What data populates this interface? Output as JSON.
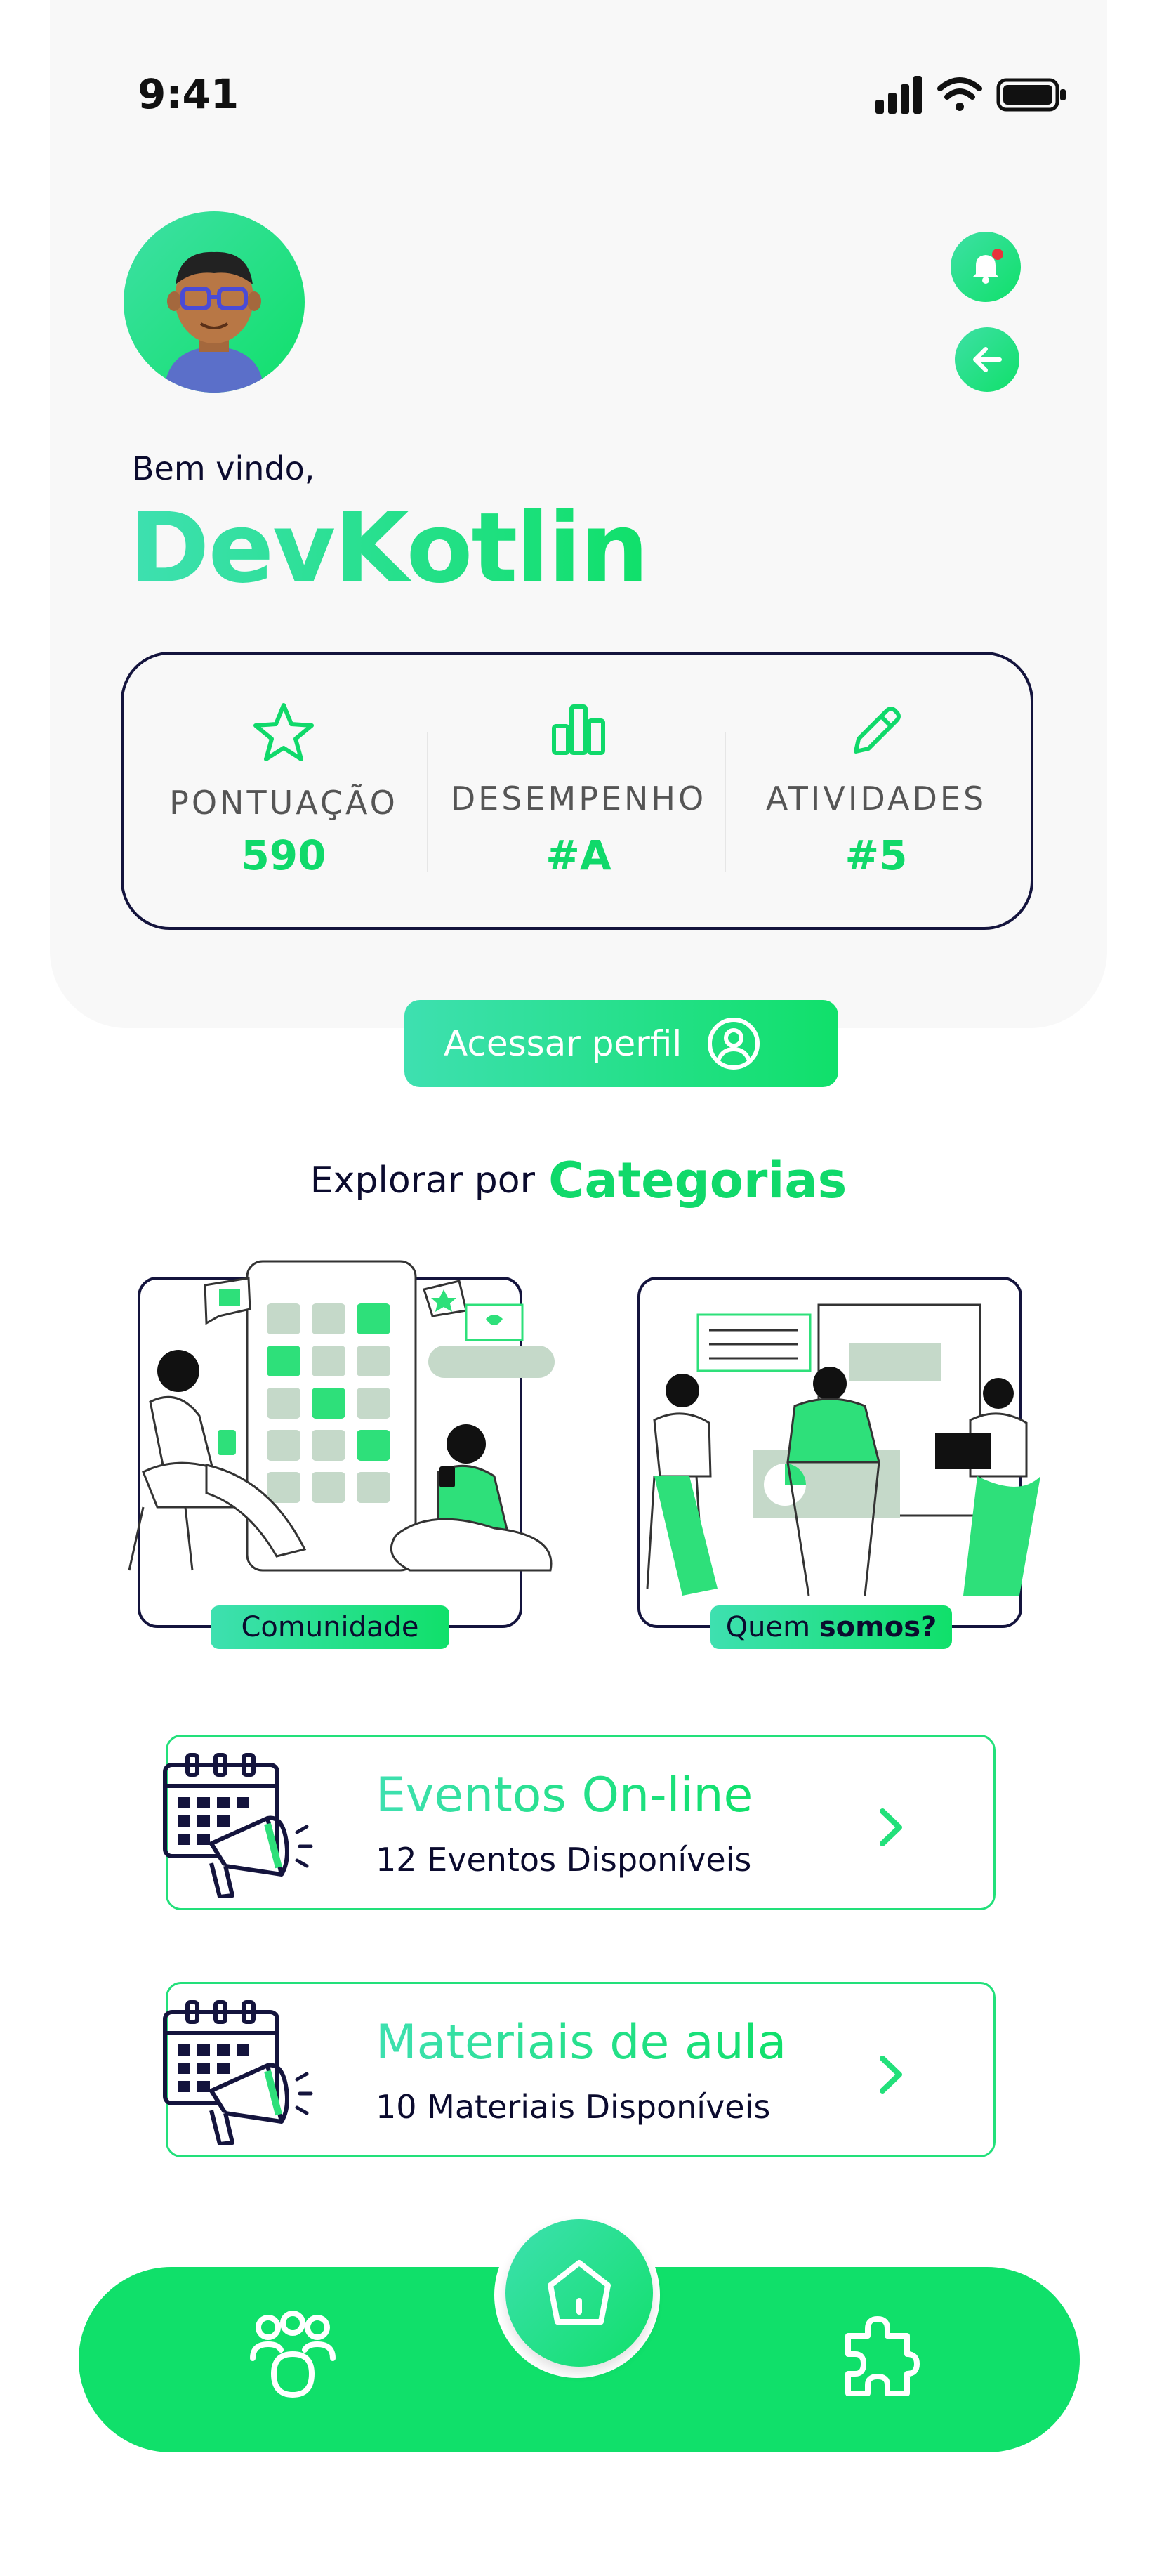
{
  "status": {
    "time": "9:41"
  },
  "header": {
    "welcome": "Bem vindo,",
    "username": "DevKotlin"
  },
  "stats": [
    {
      "label": "PONTUAÇÃO",
      "value": "590",
      "icon": "star-icon"
    },
    {
      "label": "DESEMPENHO",
      "value": "#A",
      "icon": "bar-chart-icon"
    },
    {
      "label": "ATIVIDADES",
      "value": "#5",
      "icon": "pencil-icon"
    }
  ],
  "profile_button": {
    "label": "Acessar perfil",
    "icon": "user-circle-icon"
  },
  "explore": {
    "prefix": "Explorar por",
    "highlight": "Categorias"
  },
  "categories": [
    {
      "label": "Comunidade"
    },
    {
      "label_plain": "Quem",
      "label_bold": "somos?"
    }
  ],
  "list": [
    {
      "title": "Eventos On-line",
      "subtitle": "12 Eventos Disponíveis"
    },
    {
      "title": "Materiais de aula",
      "subtitle": "10 Materiais Disponíveis"
    }
  ],
  "nav": {
    "left_icon": "community-icon",
    "center_icon": "home-icon",
    "right_icon": "puzzle-icon"
  },
  "colors": {
    "accent": "#10e06a",
    "accent_light": "#3ee0b0",
    "dark": "#14143d"
  }
}
